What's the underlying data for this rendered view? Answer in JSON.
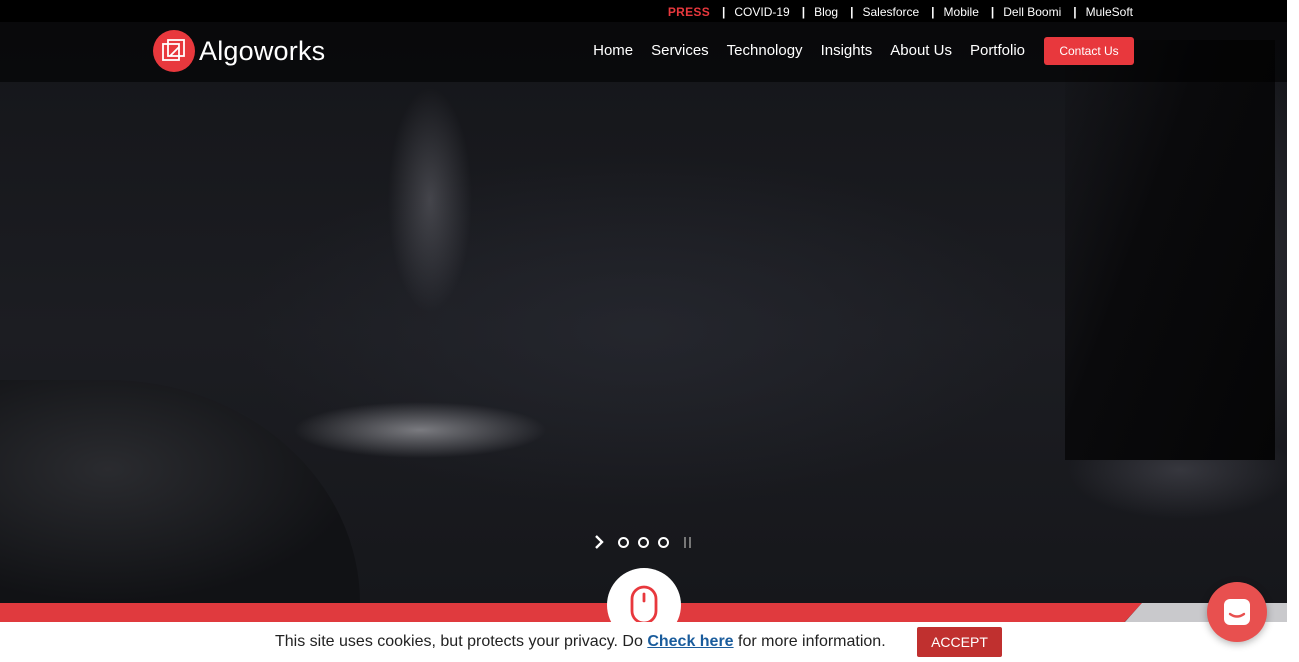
{
  "utility_bar": {
    "press": "PRESS",
    "links": [
      "COVID-19",
      "Blog",
      "Salesforce",
      "Mobile",
      "Dell Boomi",
      "MuleSoft"
    ]
  },
  "header": {
    "logo_text": "Algoworks",
    "logo_icon": "algoworks-logo-icon",
    "nav": [
      "Home",
      "Services",
      "Technology",
      "Insights",
      "About Us",
      "Portfolio"
    ],
    "contact_label": "Contact Us"
  },
  "slider": {
    "next_icon": "chevron-right-icon",
    "dots": 3,
    "pause_icon": "pause-icon"
  },
  "scroll_indicator": {
    "icon": "mouse-icon"
  },
  "cookie_bar": {
    "text_before": "This site uses cookies, but protects your privacy. Do",
    "link": "Check here",
    "text_after": "for more information.",
    "accept_label": "ACCEPT"
  },
  "chat": {
    "icon": "chat-icon"
  },
  "colors": {
    "accent_red": "#e8383d",
    "link_blue": "#1a5c9c",
    "accept_red": "#c0302f"
  }
}
